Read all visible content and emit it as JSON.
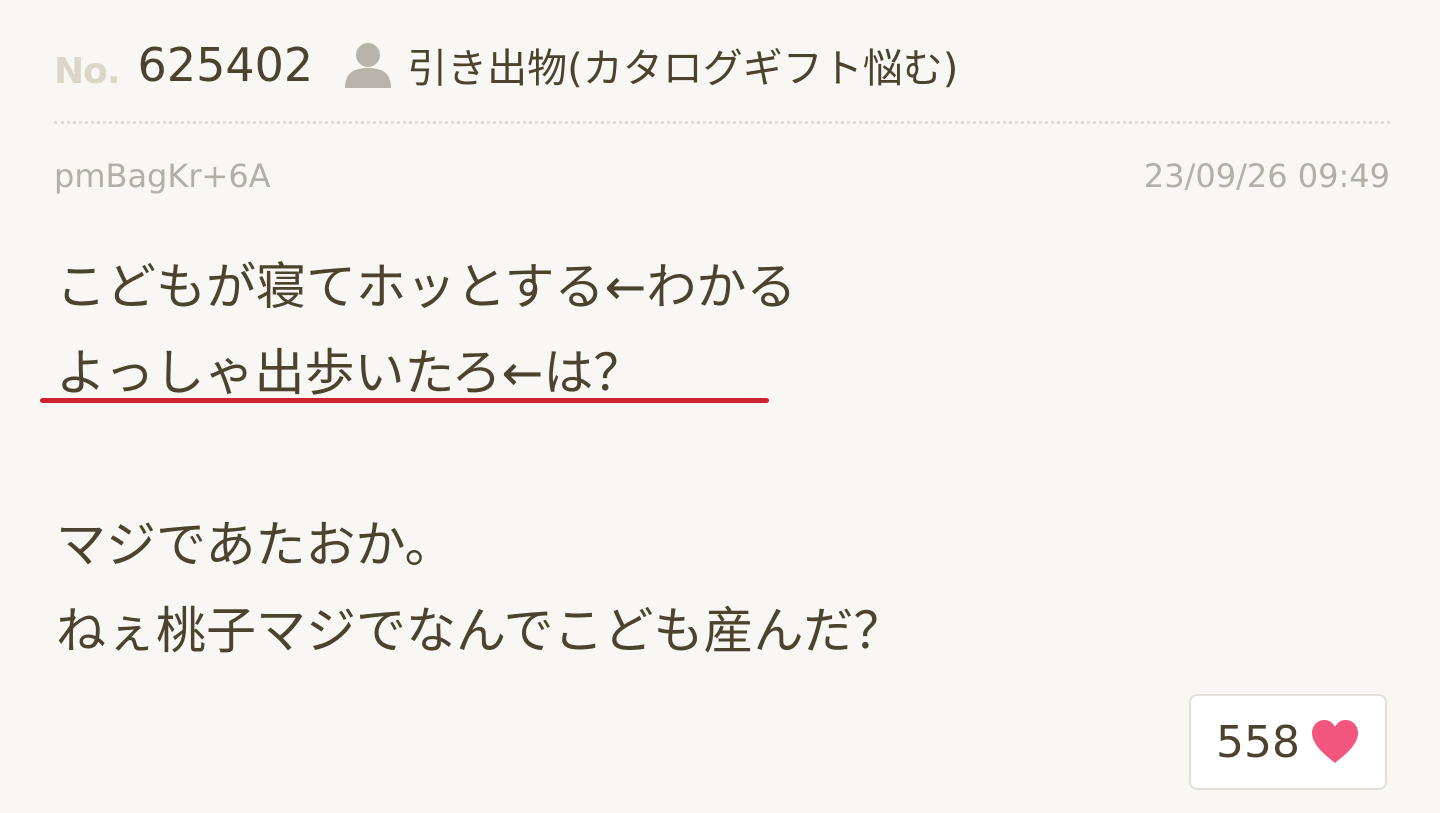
{
  "post": {
    "number_prefix": "No.",
    "number": "625402",
    "thread_title": "引き出物(カタログギフト悩む)",
    "user_id": "pmBagKr+6A",
    "timestamp": "23/09/26 09:49",
    "body_lines": [
      "こどもが寝てホッとする←わかる",
      "よっしゃ出歩いたろ←は？",
      "",
      "マジであたおか。",
      "ねぇ桃子マジでなんでこども産んだ？"
    ],
    "like_count": "558"
  },
  "icons": {
    "user": "user-icon",
    "like": "heart-icon"
  },
  "colors": {
    "background": "#f9f7f3",
    "text": "#4c432f",
    "muted": "#b3afa8",
    "underline": "#d0222d",
    "heart": "#f2557d"
  }
}
